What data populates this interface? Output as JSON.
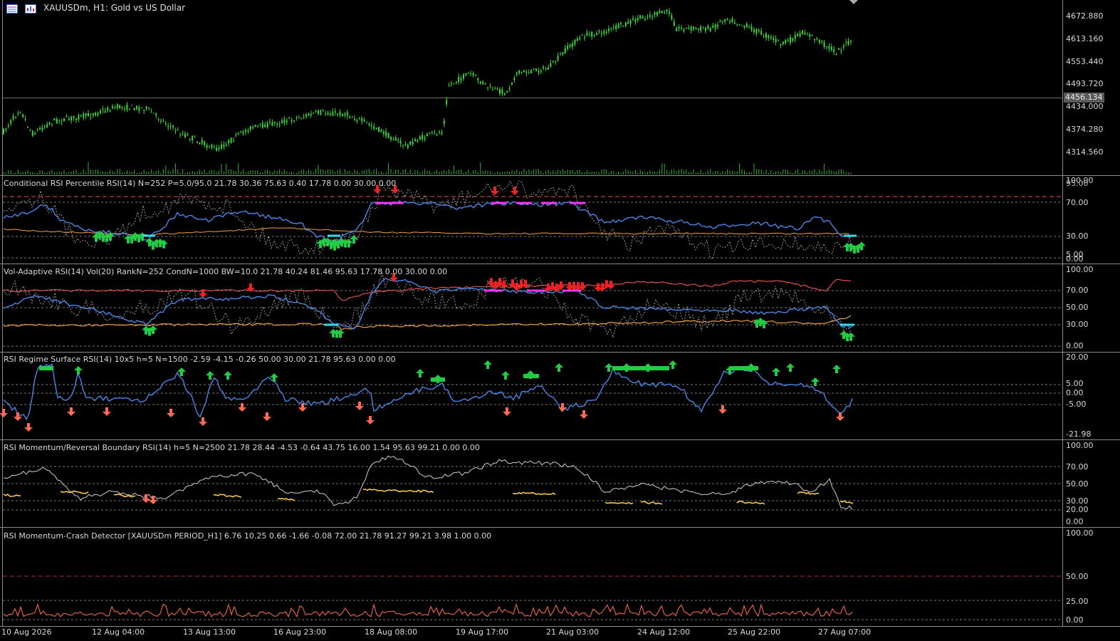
{
  "window": {
    "title": "XAUUSDm, H1:  Gold vs US Dollar",
    "current_price": "4456.134"
  },
  "colors": {
    "background": "#000000",
    "separator": "#8a8a8a",
    "candles": "#3cd43c",
    "volume": "#2fb52f",
    "rsi_blue": "#4a86e8",
    "red_band": "#e05050",
    "orange_band": "#f0a040",
    "yellow_line": "#ffd24d",
    "white_line": "#cfcfcf",
    "green_arrow": "#22cc44",
    "red_arrow": "#ee2222",
    "salmon_arrow": "#ff6a55",
    "magenta": "#ff33ff",
    "cyan": "#33ddee",
    "crash_line": "#e06045",
    "grid_dash": "#7a7a7a"
  },
  "price_axis": [
    "4672.880",
    "4613.160",
    "4553.440",
    "4493.720",
    "4434.000",
    "4374.280",
    "4314.560"
  ],
  "time_axis": [
    "10 Aug 2026",
    "12 Aug 04:00",
    "13 Aug 13:00",
    "16 Aug 23:00",
    "18 Aug 08:00",
    "19 Aug 17:00",
    "21 Aug 03:00",
    "24 Aug 12:00",
    "25 Aug 22:00",
    "27 Aug 07:00"
  ],
  "panes": [
    {
      "label": "Conditional RSI Percentile RSI(14) N=252 P=5.0/95.0 21.78 30.36 75.63 0.40 17.78 0.00 30.00 0.00",
      "axis": [
        "100.00",
        "70.00",
        "30.00",
        "0.00"
      ],
      "axis_extra": [
        "95.00",
        "5.00"
      ]
    },
    {
      "label": "Vol-Adaptive RSI(14) Vol(20) RankN=252 CondN=1000 BW=10.0 21.78 40.24 81.46 95.63 17.78 0.00 30.00 0.00",
      "axis": [
        "100.00",
        "70.00",
        "50.00",
        "30.00",
        "0.00"
      ]
    },
    {
      "label": "RSI Regime Surface RSI(14) 10x5 h=5 N=1500 -2.59 -4.15 -0.26 50.00 30.00 21.78 95.63 0.00 0.00",
      "axis": [
        "20.00",
        "5.00",
        "0.00",
        "-5.00",
        "-21.98"
      ]
    },
    {
      "label": "RSI Momentum/Reversal Boundary RSI(14) h=5 N=2500 21.78 28.44 -4.53 -0.64 43.75 16.00 1.54 95.63 99.21 0.00 0.00",
      "axis": [
        "100.00",
        "70.00",
        "50.00",
        "30.00",
        "20.00",
        "0.00"
      ]
    },
    {
      "label": "RSI Momentum-Crash Detector [XAUUSDm PERIOD_H1] 6.76 10.25 0.66 -1.66 -0.08 72.00 21.78 91.27 99.21 3.98 1.00 0.00",
      "axis": [
        "100.00",
        "50.00",
        "25.00",
        "0.00"
      ]
    }
  ]
}
